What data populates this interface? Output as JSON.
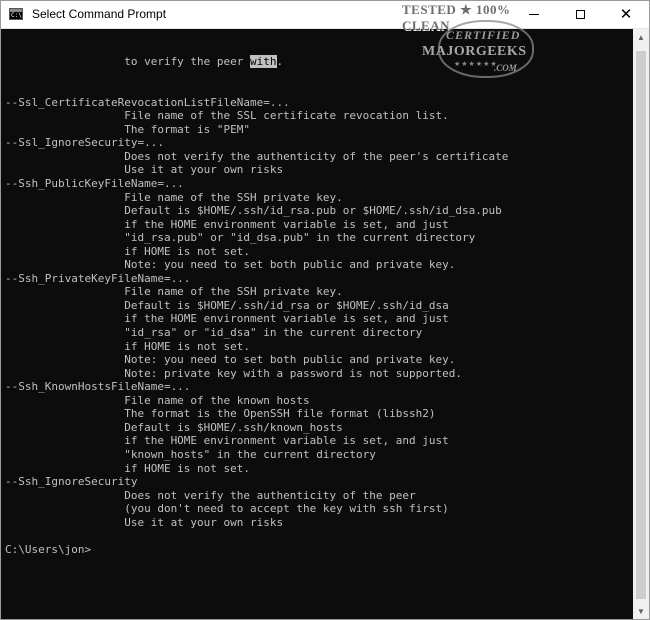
{
  "window": {
    "title": "Select Command Prompt",
    "app_icon_glyph": "C:\\",
    "buttons": {
      "minimize_icon": "minimize-icon",
      "maximize_icon": "maximize-icon",
      "close_icon": "close-icon",
      "close_glyph": "✕"
    }
  },
  "console": {
    "background": "#0c0c0c",
    "text_color": "#c0c0c0",
    "first_line_before_highlight": "                  to verify the peer ",
    "first_line_highlight": "with",
    "first_line_after_highlight": ".",
    "lines": [
      "--Ssl_CertificateRevocationListFileName=...",
      "                  File name of the SSL certificate revocation list.",
      "                  The format is \"PEM\"",
      "--Ssl_IgnoreSecurity=...",
      "                  Does not verify the authenticity of the peer's certificate",
      "                  Use it at your own risks",
      "--Ssh_PublicKeyFileName=...",
      "                  File name of the SSH private key.",
      "                  Default is $HOME/.ssh/id_rsa.pub or $HOME/.ssh/id_dsa.pub",
      "                  if the HOME environment variable is set, and just",
      "                  \"id_rsa.pub\" or \"id_dsa.pub\" in the current directory",
      "                  if HOME is not set.",
      "                  Note: you need to set both public and private key.",
      "--Ssh_PrivateKeyFileName=...",
      "                  File name of the SSH private key.",
      "                  Default is $HOME/.ssh/id_rsa or $HOME/.ssh/id_dsa",
      "                  if the HOME environment variable is set, and just",
      "                  \"id_rsa\" or \"id_dsa\" in the current directory",
      "                  if HOME is not set.",
      "                  Note: you need to set both public and private key.",
      "                  Note: private key with a password is not supported.",
      "--Ssh_KnownHostsFileName=...",
      "                  File name of the known hosts",
      "                  The format is the OpenSSH file format (libssh2)",
      "                  Default is $HOME/.ssh/known_hosts",
      "                  if the HOME environment variable is set, and just",
      "                  \"known_hosts\" in the current directory",
      "                  if HOME is not set.",
      "--Ssh_IgnoreSecurity",
      "                  Does not verify the authenticity of the peer",
      "                  (you don't need to accept the key with ssh first)",
      "                  Use it at your own risks",
      "",
      "C:\\Users\\jon>"
    ]
  },
  "scrollbar": {
    "up_icon": "scroll-up-arrow-icon",
    "down_icon": "scroll-down-arrow-icon",
    "up_glyph": "▲",
    "down_glyph": "▼"
  },
  "watermark": {
    "top_text": "TESTED ★ 100% CLEAN",
    "certified": "CERTIFIED",
    "brand": "MAJORGEEKS",
    "stars": "★★★★★★",
    "suffix": ".COM"
  }
}
